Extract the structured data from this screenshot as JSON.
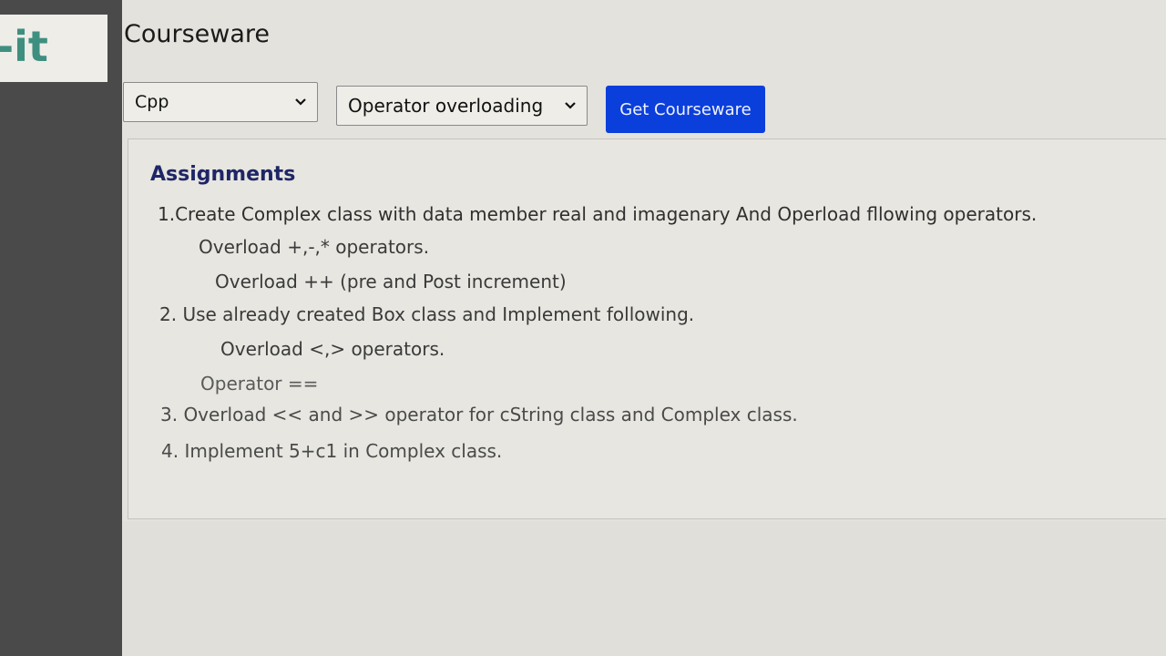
{
  "logo": {
    "text": "-it"
  },
  "header": {
    "title": "Courseware"
  },
  "toolbar": {
    "language_select": {
      "value": "Cpp"
    },
    "topic_select": {
      "value": "Operator overloading"
    },
    "get_button_label": "Get Courseware"
  },
  "assignments": {
    "heading": "Assignments",
    "lines": [
      "1.Create Complex class with data member real and imagenary  And Operload fllowing operators.",
      "Overload +,-,* operators.",
      "Overload ++ (pre and Post increment)",
      "2. Use already created Box class and Implement following.",
      "Overload <,> operators.",
      "Operator ==",
      "3. Overload << and >> operator for cString class and Complex class.",
      "4. Implement 5+c1 in Complex class."
    ]
  },
  "colors": {
    "button_bg": "#0b3fdc",
    "heading": "#1f2666",
    "logo": "#3f8f80",
    "sidebar": "#4a4a4a"
  },
  "icons": {
    "select_arrow": "chevron-down-icon"
  }
}
